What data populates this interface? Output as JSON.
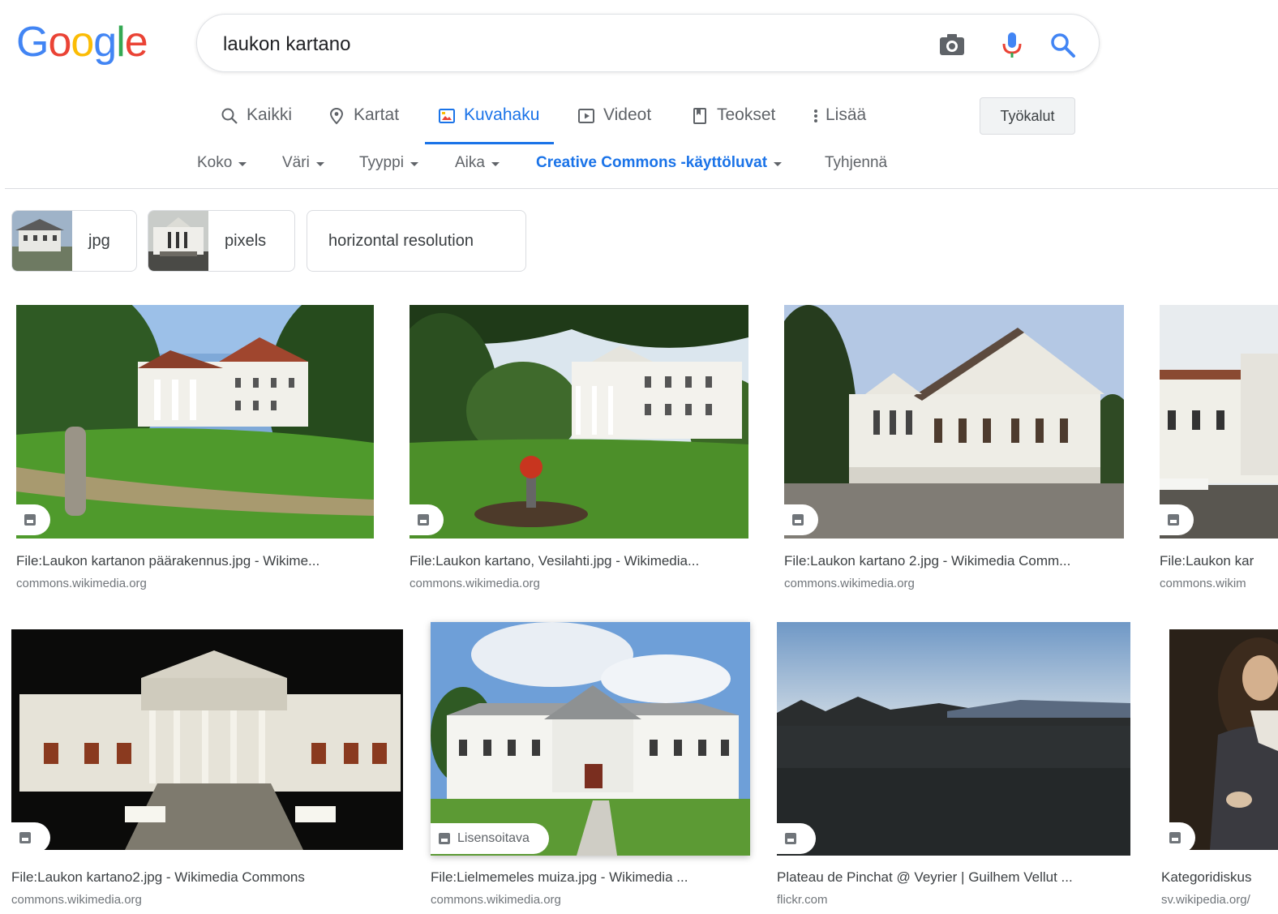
{
  "logo": {
    "letters": [
      "G",
      "o",
      "o",
      "g",
      "l",
      "e"
    ],
    "colors": [
      "#4285F4",
      "#EA4335",
      "#FBBC05",
      "#4285F4",
      "#34A853",
      "#EA4335"
    ]
  },
  "search": {
    "query": "laukon kartano",
    "camera_icon": "camera-icon",
    "mic_icon": "mic-icon",
    "search_icon": "search-icon"
  },
  "tabs": [
    {
      "label": "Kaikki",
      "icon": "search-icon"
    },
    {
      "label": "Kartat",
      "icon": "map-pin-icon"
    },
    {
      "label": "Kuvahaku",
      "icon": "image-icon",
      "active": true
    },
    {
      "label": "Videot",
      "icon": "play-icon"
    },
    {
      "label": "Teokset",
      "icon": "book-icon"
    },
    {
      "label": "Lisää",
      "icon": "more-vert-icon"
    }
  ],
  "tools_label": "Työkalut",
  "filters": [
    {
      "label": "Koko"
    },
    {
      "label": "Väri"
    },
    {
      "label": "Tyyppi"
    },
    {
      "label": "Aika"
    },
    {
      "label": "Creative Commons -käyttöluvat"
    },
    {
      "label": "Tyhjennä"
    }
  ],
  "chips": [
    {
      "label": "jpg"
    },
    {
      "label": "pixels"
    },
    {
      "label": "horizontal resolution"
    }
  ],
  "results": [
    {
      "title": "File:Laukon kartanon päärakennus.jpg - Wikime...",
      "source": "commons.wikimedia.org",
      "badge": ""
    },
    {
      "title": "File:Laukon kartano, Vesilahti.jpg - Wikimedia...",
      "source": "commons.wikimedia.org",
      "badge": ""
    },
    {
      "title": "File:Laukon kartano 2.jpg - Wikimedia Comm...",
      "source": "commons.wikimedia.org",
      "badge": ""
    },
    {
      "title": "File:Laukon kar",
      "source": "commons.wikim",
      "badge": ""
    },
    {
      "title": "File:Laukon kartano2.jpg - Wikimedia Commons",
      "source": "commons.wikimedia.org",
      "badge": ""
    },
    {
      "title": "File:Lielmemeles muiza.jpg - Wikimedia ...",
      "source": "commons.wikimedia.org",
      "badge": "Lisensoitava"
    },
    {
      "title": "Plateau de Pinchat @ Veyrier | Guilhem Vellut ...",
      "source": "flickr.com",
      "badge": ""
    },
    {
      "title": "Kategoridiskus",
      "source": "sv.wikipedia.org/",
      "badge": ""
    }
  ]
}
